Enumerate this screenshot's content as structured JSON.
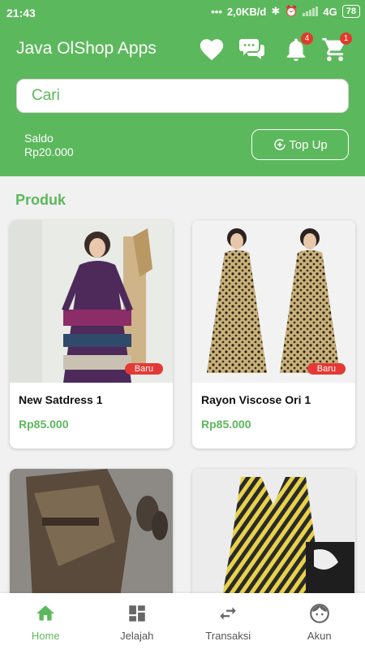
{
  "statusbar": {
    "time": "21:43",
    "dots": "•••",
    "speed": "2,0KB/d",
    "network": "4G",
    "battery": "78"
  },
  "app": {
    "title": "Java OlShop Apps"
  },
  "topbar": {
    "notification_count": "4",
    "cart_count": "1"
  },
  "search": {
    "placeholder": "Cari"
  },
  "balance": {
    "label": "Saldo",
    "value": "Rp20.000",
    "topup_label": "Top Up"
  },
  "section": {
    "title": "Produk"
  },
  "products": [
    {
      "name": "New Satdress 1",
      "price": "Rp85.000",
      "tag": "Baru"
    },
    {
      "name": "Rayon Viscose Ori 1",
      "price": "Rp85.000",
      "tag": "Baru"
    },
    {
      "name": "",
      "price": "",
      "tag": ""
    },
    {
      "name": "",
      "price": "",
      "tag": ""
    }
  ],
  "nav": [
    {
      "label": "Home",
      "icon": "home-icon"
    },
    {
      "label": "Jelajah",
      "icon": "grid-icon"
    },
    {
      "label": "Transaksi",
      "icon": "swap-icon"
    },
    {
      "label": "Akun",
      "icon": "face-icon"
    }
  ],
  "colors": {
    "primary": "#5cb85c",
    "badge": "#e23a2c",
    "tag": "#e53935"
  }
}
